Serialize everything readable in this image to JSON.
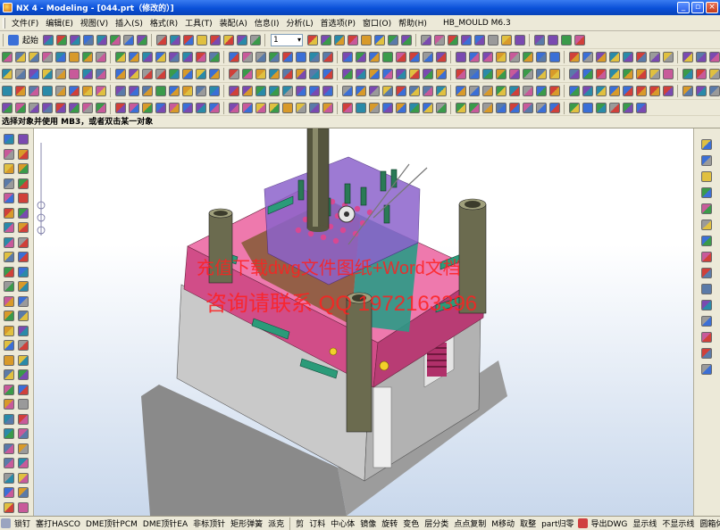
{
  "window": {
    "title": "NX 4 - Modeling - [044.prt（修改的）]",
    "minimize": "_",
    "restore": "▫",
    "close": "×"
  },
  "menu": [
    "文件(F)",
    "编辑(E)",
    "视图(V)",
    "插入(S)",
    "格式(R)",
    "工具(T)",
    "装配(A)",
    "信息(I)",
    "分析(L)",
    "首选项(P)",
    "窗口(O)",
    "帮助(H)"
  ],
  "menu_doc": "HB_MOULD M6.3",
  "toolbar": {
    "start_label": "起始",
    "layer_value": "1"
  },
  "status": {
    "prompt": "选择对象并使用 MB3，或者双击某一对象"
  },
  "watermark": {
    "line1": "充值下载dwg文件图纸+Word文档",
    "line2": "咨询请联系 QQ 1972163396"
  },
  "bottom_toolbar": [
    "锁钉",
    "塞打HASCO",
    "DME顶针PCM",
    "DME顶针EA",
    "非标顶针",
    "矩形弹簧",
    "派克",
    "剪",
    "订料",
    "中心体",
    "镜像",
    "旋转",
    "变色",
    "层分类",
    "点点复制",
    "M移动",
    "取整",
    "part归零",
    "导出DWG",
    "显示线",
    "不显示线",
    "圆箱体"
  ],
  "colors": {
    "titlebar": "#0a50d8",
    "mold_plate": "#e8609a",
    "base": "#c8c8c8",
    "pillar": "#6b6b4f",
    "cavity_insert": "#7b58c2",
    "core_insert": "#2a9a86",
    "clamp": "#2b9b79",
    "watermark": "#ff2020"
  }
}
